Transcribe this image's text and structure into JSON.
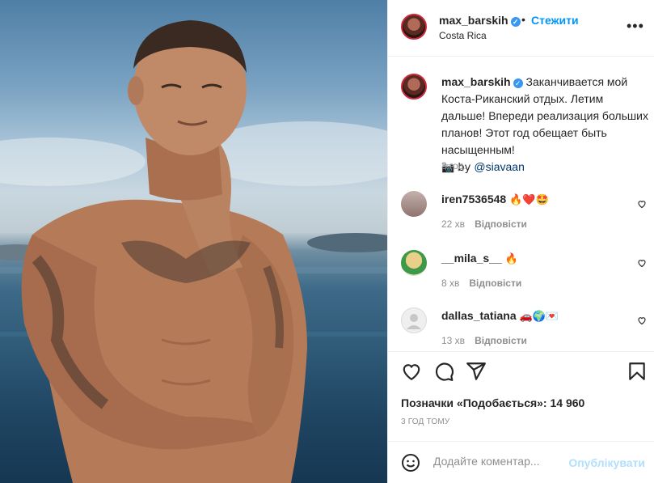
{
  "post": {
    "username": "max_barskih",
    "verified_mark": "✓",
    "separator": "•",
    "follow_label": "Стежити",
    "location": "Costa Rica",
    "more_label": "•••",
    "caption_line1": "Заканчивается мой Коста-Риканский отдых. Летим дальше! Впереди реализация больших планов! Этот год обещает быть насыщенным!",
    "caption_credit_prefix": "📷 by ",
    "caption_credit_link": "@siavaan",
    "caption_time": "3 год."
  },
  "comments": [
    {
      "user": "iren7536548",
      "emoji": "🔥❤️🤩",
      "time": "22 хв",
      "reply": "Відповісти",
      "avatar_color": "#a58a86"
    },
    {
      "user": "__mila_s__",
      "emoji": "🔥",
      "time": "8 хв",
      "reply": "Відповісти",
      "avatar_color": "#d9b35b"
    },
    {
      "user": "dallas_tatiana",
      "emoji": "🚗🌍💌",
      "time": "13 хв",
      "reply": "Відповісти",
      "avatar_color": "#dbdbdb"
    }
  ],
  "actions": {
    "like_icon": "heart-icon",
    "comment_icon": "comment-icon",
    "share_icon": "share-icon",
    "save_icon": "bookmark-icon"
  },
  "likes_text": "Позначки «Подобається»: 14 960",
  "posted_ago": "3 ГОД ТОМУ",
  "comment_box": {
    "placeholder": "Додайте коментар...",
    "publish_label": "Опублікувати"
  },
  "colors": {
    "accent": "#0095f6",
    "verified": "#3897f0",
    "publish_disabled": "#b2dffc"
  }
}
